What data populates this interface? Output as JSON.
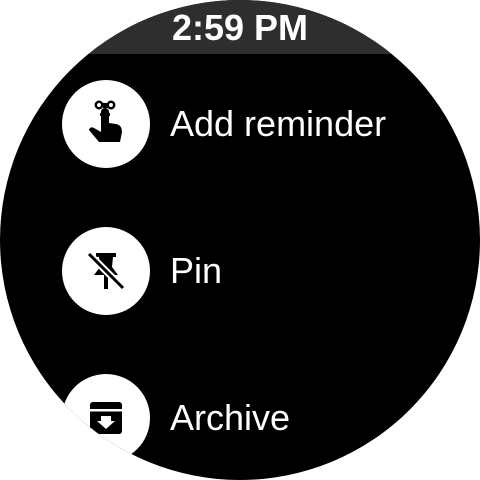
{
  "status_bar": {
    "time": "2:59 PM"
  },
  "menu": {
    "items": [
      {
        "label": "Add reminder",
        "icon": "finger-string-reminder-icon"
      },
      {
        "label": "Pin",
        "icon": "pin-off-icon"
      },
      {
        "label": "Archive",
        "icon": "archive-icon"
      }
    ]
  },
  "colors": {
    "background": "#000000",
    "status_bar": "#2e2e2e",
    "text": "#ffffff",
    "icon_circle": "#ffffff",
    "icon_glyph": "#000000"
  }
}
